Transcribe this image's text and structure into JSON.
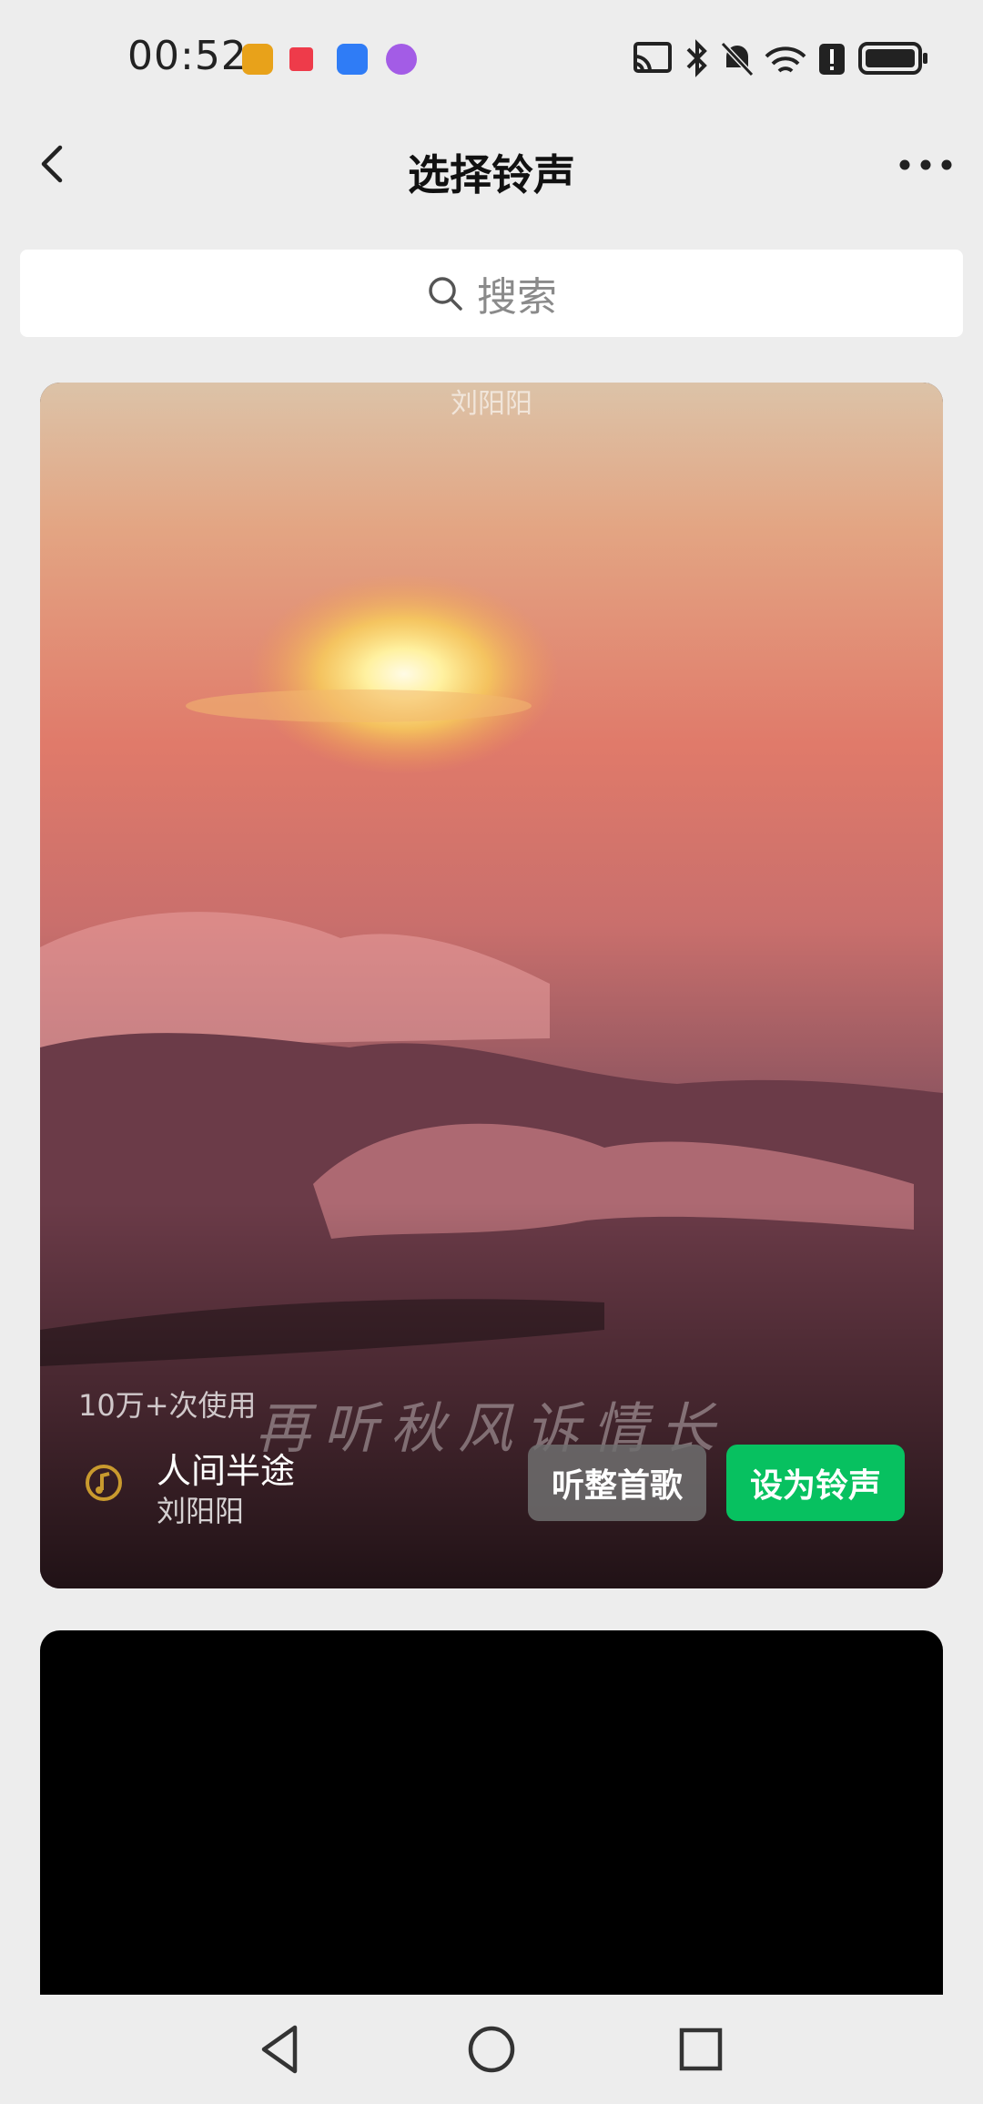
{
  "status_bar": {
    "time": "00:52",
    "left_icons": [
      "sohu-app-icon",
      "red-app-icon",
      "cloud-app-icon",
      "purple-app-icon"
    ],
    "right_icons": [
      "cast-icon",
      "bluetooth-icon",
      "mute-icon",
      "wifi-icon",
      "alert-icon",
      "battery-icon"
    ]
  },
  "header": {
    "title": "选择铃声",
    "back_icon": "chevron-left-icon",
    "more_icon": "more-horizontal-icon"
  },
  "search": {
    "placeholder": "搜索",
    "icon": "search-icon"
  },
  "ringtone_card": {
    "overlay_artist": "刘阳阳",
    "caption": "再听秋风诉情长",
    "usage": "10万+次使用",
    "song_title": "人间半途",
    "song_artist": "刘阳阳",
    "listen_button": "听整首歌",
    "set_button": "设为铃声",
    "accent_color": "#07c160"
  },
  "nav_bar": {
    "icons": [
      "back-triangle-icon",
      "home-circle-icon",
      "recents-square-icon"
    ]
  }
}
